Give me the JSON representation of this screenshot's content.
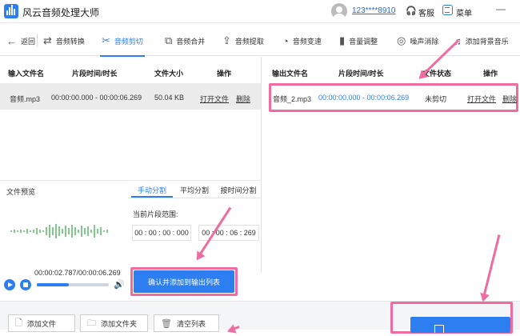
{
  "app": {
    "title": "风云音频处理大师",
    "account": "123****8910",
    "service": "客服",
    "menu": "菜单"
  },
  "toolbar": {
    "back": "返回",
    "items": [
      "音频转换",
      "音频剪切",
      "音频合并",
      "音频提取",
      "音频变速",
      "音量调整",
      "噪声消除",
      "添加背景音乐"
    ],
    "active": "音频剪切"
  },
  "input_table": {
    "headers": [
      "输入文件名",
      "片段时间/时长",
      "文件大小",
      "操作"
    ],
    "rows": [
      {
        "name": "音频.mp3",
        "time": "00:00:00.000 - 00:00:06.269",
        "size": "50.04 KB",
        "open": "打开文件",
        "delete": "删除"
      }
    ]
  },
  "output_table": {
    "headers": [
      "输出文件名",
      "片段时间/时长",
      "文件状态",
      "操作"
    ],
    "rows": [
      {
        "name": "音频_2.mp3",
        "time": "00:00:00.000 - 00:00:06.269",
        "status": "未剪切",
        "open": "打开文件",
        "delete": "删除"
      }
    ]
  },
  "preview": {
    "label": "文件预览",
    "time": "00:00:02.787/00:00:06.269",
    "progress": 0.44
  },
  "split_tabs": [
    "手动分割",
    "平均分割",
    "按时间分割"
  ],
  "range": {
    "label": "当前片段范围:",
    "start": "00 : 00 : 00 : 000",
    "end": "00 : 00 : 06 : 269"
  },
  "confirm_button": "确认并添加到输出列表",
  "bottom": {
    "add_file": "添加文件",
    "add_folder": "添加文件夹",
    "clear": "清空列表"
  },
  "colors": {
    "accent": "#2d7ef0",
    "highlight": "#f06ca0"
  },
  "icons": [
    "logo-icon",
    "avatar-icon",
    "headset-icon",
    "menu-icon",
    "minimize-icon",
    "back-arrow-icon",
    "convert-icon",
    "scissors-icon",
    "merge-icon",
    "extract-icon",
    "speed-icon",
    "volume-bars-icon",
    "noise-icon",
    "music-icon",
    "play-icon",
    "stop-icon",
    "speaker-icon",
    "add-file-icon",
    "add-folder-icon",
    "trash-icon"
  ]
}
